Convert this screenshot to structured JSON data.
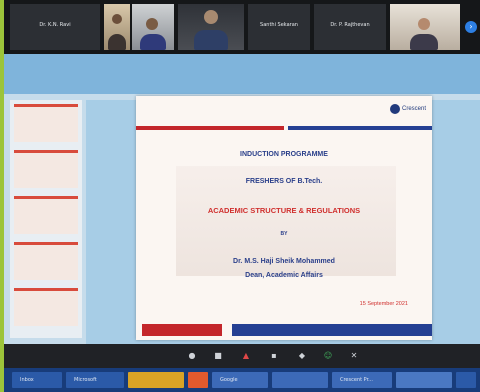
{
  "participants": [
    {
      "name": "Dr. K.N. Ravi",
      "has_video": false
    },
    {
      "name": "",
      "has_video": true
    },
    {
      "name": "",
      "has_video": true
    },
    {
      "name": "",
      "has_video": true
    },
    {
      "name": "Santhi Sekaran",
      "has_video": false
    },
    {
      "name": "Dr. P. Rajthevan",
      "has_video": false
    },
    {
      "name": "",
      "has_video": true
    }
  ],
  "slide": {
    "logo_text": "Crescent",
    "line1": "INDUCTION PROGRAMME",
    "line2": "FRESHERS OF B.Tech.",
    "line3": "ACADEMIC STRUCTURE & REGULATIONS",
    "line4": "BY",
    "line5": "Dr. M.S. Haji Sheik Mohammed",
    "line6": "Dean, Academic Affairs",
    "date": "15 September 2021"
  },
  "controls": [
    "mute-icon",
    "video-icon",
    "share-icon",
    "chat-icon",
    "participants-icon",
    "reactions-icon",
    "end-icon"
  ],
  "taskbar_items": [
    "Inbox",
    "Microsoft",
    "",
    "",
    "Google",
    "",
    "Crescent Pr...",
    "",
    "",
    ""
  ],
  "colors": {
    "accent_red": "#c3262b",
    "accent_blue": "#254093",
    "taskbar": "#183c7a"
  }
}
